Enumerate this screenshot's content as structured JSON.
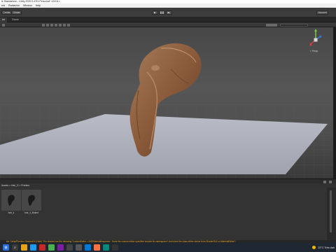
{
  "window": {
    "title": "ie Standalone - Unity 2020.3.47f1 Personal* <DX11>"
  },
  "menu": {
    "items": [
      "ent",
      "Radiacion",
      "Window",
      "Help"
    ]
  },
  "toolbar": {
    "center_label": "Center",
    "global_label": "Global",
    "play_icon": "▶",
    "pause_icon": "❚❚",
    "step_icon": "▶|",
    "account_label": "Account"
  },
  "tabs": {
    "scene": "ne",
    "game": "Game"
  },
  "scene_view": {
    "gizmo_label": "< Persp",
    "gizmo_axes": {
      "y": "y",
      "z": "z",
      "x": "x"
    },
    "colors": {
      "y": "#7ac943",
      "z": "#3d7bd8",
      "x": "#d23d3d"
    }
  },
  "project": {
    "breadcrumb": "Assets > Hair_S > Prefabs",
    "assets": [
      {
        "label": "hair_4"
      },
      {
        "label": "hair_4_Baked"
      }
    ]
  },
  "status": {
    "message": "der 'Unity/Preview Shadow14 (Hide)' The shader has the following 'CustomEditor = ASEMaterialInspector'. Does the custom editor specified include its namespace? And does the class either derive from ShaderGUI or MaterialEditor?"
  },
  "taskbar": {
    "weather": "22°C  Très clair"
  }
}
